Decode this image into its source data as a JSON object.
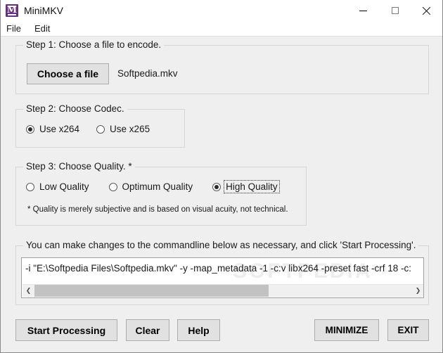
{
  "window": {
    "title": "MiniMKV",
    "icon": "app-icon-minimkv",
    "controls": {
      "minimize": "–",
      "maximize": "□",
      "close": "✕"
    }
  },
  "menu": {
    "items": [
      {
        "label": "File"
      },
      {
        "label": "Edit"
      }
    ]
  },
  "step1": {
    "legend": "Step 1: Choose a file to encode.",
    "choose_file_label": "Choose a file",
    "selected_file": "Softpedia.mkv"
  },
  "step2": {
    "legend": "Step 2: Choose Codec.",
    "options": [
      {
        "label": "Use x264",
        "checked": true
      },
      {
        "label": "Use x265",
        "checked": false
      }
    ]
  },
  "step3": {
    "legend": "Step 3: Choose Quality. *",
    "options": [
      {
        "label": "Low Quality",
        "checked": false
      },
      {
        "label": "Optimum Quality",
        "checked": false
      },
      {
        "label": "High Quality",
        "checked": true
      }
    ],
    "note": "* Quality is merely subjective and is based on visual acuity, not technical."
  },
  "commandline": {
    "legend": "You can make changes to the commandline below as necessary, and click 'Start Processing'.",
    "value": "-i \"E:\\Softpedia Files\\Softpedia.mkv\" -y -map_metadata -1 -c:v libx264 -preset fast -crf 18 -c:",
    "watermark": "SOFTPEDIA",
    "watermark_mark": "®",
    "scroll_left_icon": "❮",
    "scroll_right_icon": "❯"
  },
  "actions": {
    "start_processing": "Start Processing",
    "clear": "Clear",
    "help": "Help",
    "minimize": "MINIMIZE",
    "exit": "EXIT"
  },
  "colors": {
    "accent": "#67307e",
    "window_bg": "#efefef",
    "button_bg": "#e1e1e1",
    "field_bg": "#ffffff"
  }
}
